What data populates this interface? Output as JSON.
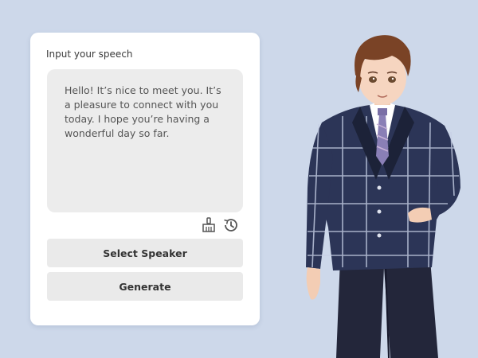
{
  "panel": {
    "label": "Input your speech",
    "speech_text": "Hello! It’s nice to meet you. It’s a pleasure to connect with you today. I hope you’re having a wonderful day so far.",
    "clear_icon": "broom-icon",
    "history_icon": "history-icon"
  },
  "buttons": {
    "select_speaker": "Select Speaker",
    "generate": "Generate"
  },
  "colors": {
    "background": "#cdd8ea",
    "panel": "#ffffff",
    "text_area": "#ececec",
    "button": "#eaeaea"
  }
}
